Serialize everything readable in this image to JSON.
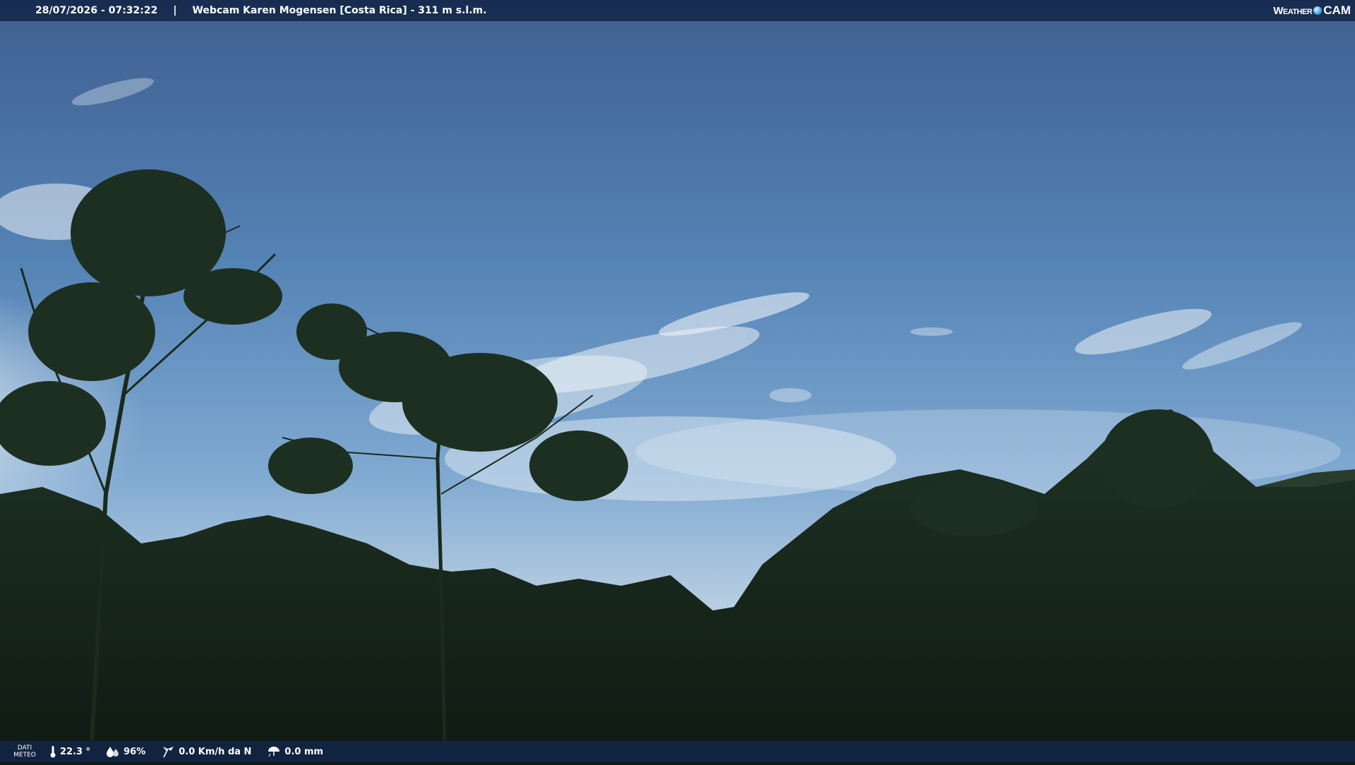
{
  "header": {
    "datetime": "28/07/2026 - 07:32:22",
    "separator": "|",
    "location": "Webcam Karen Mogensen [Costa Rica]  - 311 m s.l.m.",
    "logo_weather": "Weather",
    "logo_cam": "CAM"
  },
  "footer": {
    "label_line1": "DATI",
    "label_line2": "METEO",
    "temperature": "22.3 °",
    "humidity": "96%",
    "wind": "0.0 Km/h da N",
    "rain": "0.0 mm"
  },
  "icons": [
    "thermometer-icon",
    "humidity-icon",
    "wind-icon",
    "rain-icon",
    "globe-icon"
  ],
  "colors": {
    "bar": "#122648",
    "sky_top": "#3d5f8e",
    "sky_mid": "#5f8fbf",
    "vegetation": "#16241a"
  }
}
